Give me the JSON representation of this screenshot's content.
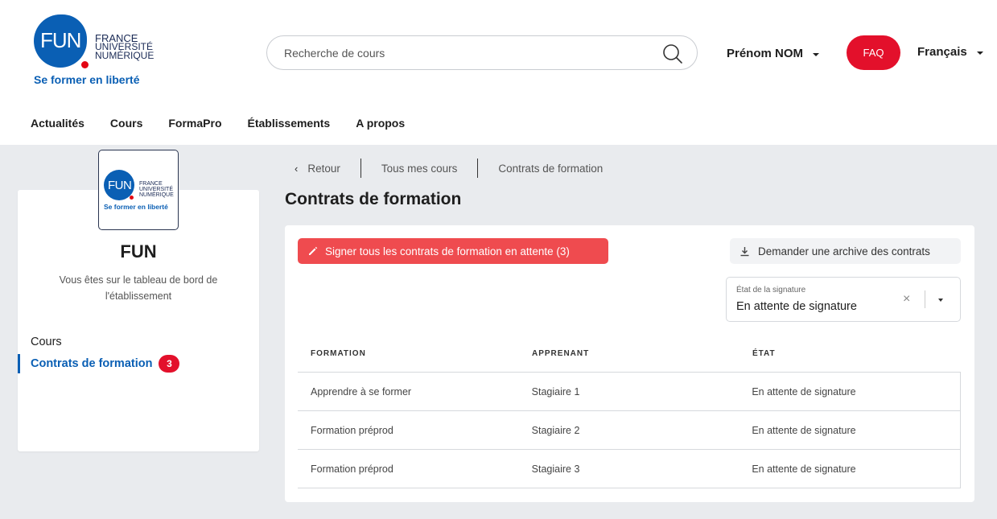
{
  "header": {
    "logo": {
      "mark": "FUN",
      "line1": "FRANCE",
      "line2": "UNIVERSITÉ",
      "line3": "NUMÉRIQUE",
      "tagline": "Se former en liberté"
    },
    "search": {
      "placeholder": "Recherche de cours",
      "icon": "search-icon"
    },
    "user_menu": {
      "label": "Prénom NOM"
    },
    "faq_label": "FAQ",
    "language": {
      "label": "Français"
    },
    "nav": [
      "Actualités",
      "Cours",
      "FormaPro",
      "Établissements",
      "A propos"
    ]
  },
  "sidebar": {
    "logo": {
      "mark": "FUN",
      "line1": "FRANCE",
      "line2": "UNIVERSITÉ",
      "line3": "NUMÉRIQUE",
      "tagline": "Se former en liberté"
    },
    "title": "FUN",
    "description": "Vous êtes sur le tableau de bord de l'établissement",
    "items": [
      {
        "label": "Cours"
      },
      {
        "label": "Contrats de formation",
        "badge": "3",
        "active": true
      }
    ]
  },
  "breadcrumb": {
    "back": "Retour",
    "items": [
      "Tous mes cours",
      "Contrats de formation"
    ]
  },
  "page": {
    "title": "Contrats de formation",
    "sign_all_label": "Signer tous les contrats de formation en attente (3)",
    "archive_label": "Demander une archive des contrats",
    "filter": {
      "label": "État de la signature",
      "value": "En attente de signature"
    }
  },
  "table": {
    "columns": [
      "FORMATION",
      "APPRENANT",
      "ÉTAT"
    ],
    "rows": [
      [
        "Apprendre à se former",
        "Stagiaire 1",
        "En attente de signature"
      ],
      [
        "Formation préprod",
        "Stagiaire 2",
        "En attente de signature"
      ],
      [
        "Formation préprod",
        "Stagiaire 3",
        "En attente de signature"
      ]
    ]
  },
  "colors": {
    "brand_blue": "#0a5fb4",
    "accent_red": "#e3102b",
    "sign_button": "#ef4b4f",
    "background": "#e9ebee"
  }
}
